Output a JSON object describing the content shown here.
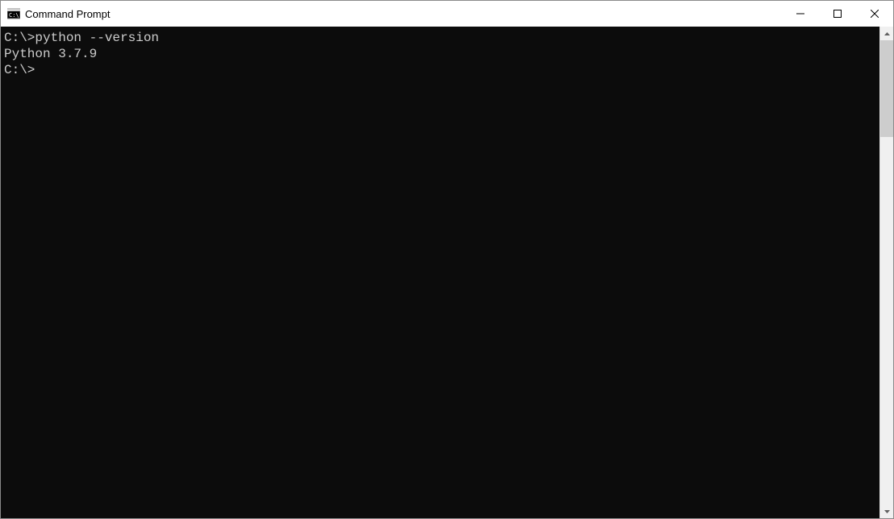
{
  "window": {
    "title": "Command Prompt"
  },
  "terminal": {
    "lines": {
      "l0": "C:\\>python --version",
      "l1": "Python 3.7.9",
      "l2": "",
      "l3": "C:\\>"
    }
  }
}
